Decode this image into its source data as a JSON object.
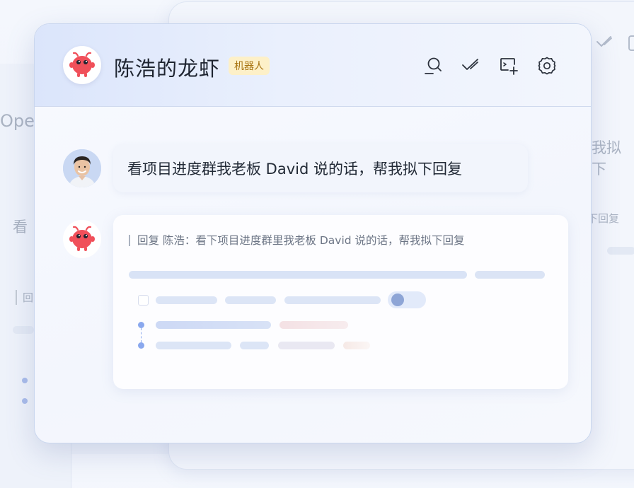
{
  "window": {
    "title": "陈浩的龙虾",
    "badge": "机器人"
  },
  "header_icons": [
    "search-icon",
    "check-icon",
    "new-chat-icon",
    "settings-icon"
  ],
  "messages": {
    "user_text": "看项目进度群我老板 David 说的话，帮我拟下回复",
    "bot_quote": "回复 陈浩：看下项目进度群里我老板 David 说的话，帮我拟下回复"
  },
  "background": {
    "left_partial_title": "Ope",
    "left_partial_msg": "看",
    "left_partial_quote": "回",
    "right_partial_msg": "我拟下",
    "right_partial_quote": "下回复"
  },
  "colors": {
    "badge_bg": "#fdf0c8",
    "badge_text": "#a87412",
    "robot_red": "#f0505a",
    "skeleton": "#dce5f6",
    "timeline": "#8aa8ee"
  }
}
